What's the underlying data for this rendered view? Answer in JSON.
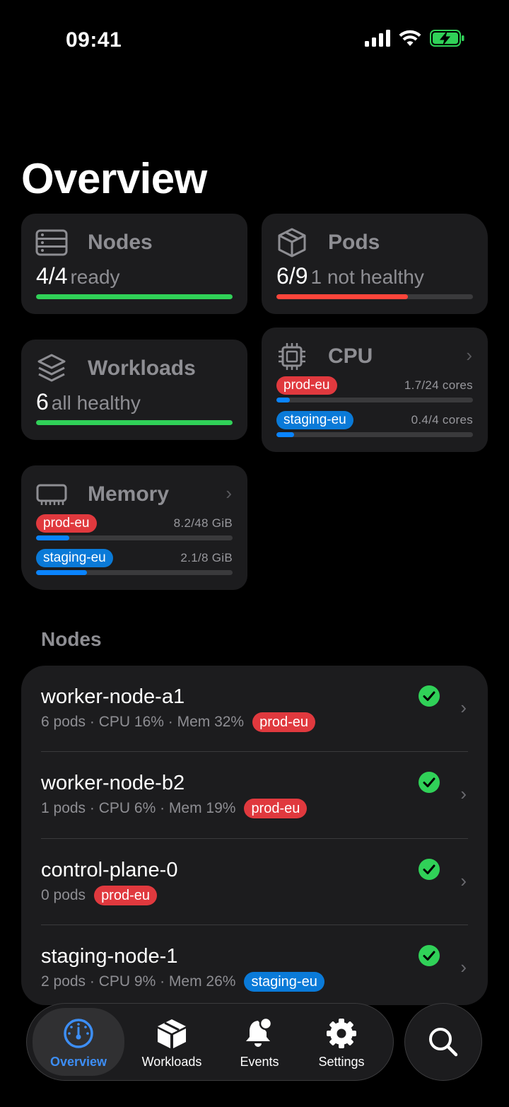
{
  "status": {
    "time": "09:41"
  },
  "page_title": "Overview",
  "cards": {
    "nodes": {
      "label": "Nodes",
      "value": "4/4",
      "sub": "ready",
      "progress": 1.0,
      "color": "#30d158",
      "icon": "server-rack-icon"
    },
    "pods": {
      "label": "Pods",
      "value": "6/9",
      "sub": "1 not healthy",
      "progress": 0.67,
      "color": "#ff453a",
      "icon": "cube-icon"
    },
    "workloads": {
      "label": "Workloads",
      "value": "6",
      "sub": "all healthy",
      "progress": 1.0,
      "color": "#30d158",
      "icon": "stack-layers-icon"
    },
    "cpu": {
      "label": "CPU",
      "icon": "cpu-chip-icon",
      "rows": [
        {
          "cluster": "prod-eu",
          "amount": "1.7/24 cores",
          "progress": 0.07,
          "color": "red"
        },
        {
          "cluster": "staging-eu",
          "amount": "0.4/4 cores",
          "progress": 0.09,
          "color": "blue"
        }
      ]
    },
    "memory": {
      "label": "Memory",
      "icon": "memory-module-icon",
      "rows": [
        {
          "cluster": "prod-eu",
          "amount": "8.2/48 GiB",
          "progress": 0.17,
          "color": "red"
        },
        {
          "cluster": "staging-eu",
          "amount": "2.1/8 GiB",
          "progress": 0.26,
          "color": "blue"
        }
      ]
    }
  },
  "nodes_section": {
    "title": "Nodes",
    "items": [
      {
        "name": "worker-node-a1",
        "meta": "6 pods · CPU 16% · Mem 32%",
        "cluster": "prod-eu",
        "cluster_color": "red"
      },
      {
        "name": "worker-node-b2",
        "meta": "1 pods · CPU 6% · Mem 19%",
        "cluster": "prod-eu",
        "cluster_color": "red"
      },
      {
        "name": "control-plane-0",
        "meta": "0 pods",
        "cluster": "prod-eu",
        "cluster_color": "red"
      },
      {
        "name": "staging-node-1",
        "meta": "2 pods · CPU 9% · Mem 26%",
        "cluster": "staging-eu",
        "cluster_color": "blue"
      }
    ]
  },
  "tabs": [
    {
      "label": "Overview",
      "icon": "gauge-icon",
      "active": true
    },
    {
      "label": "Workloads",
      "icon": "box-icon",
      "active": false
    },
    {
      "label": "Events",
      "icon": "bell-badge-icon",
      "active": false
    },
    {
      "label": "Settings",
      "icon": "gear-icon",
      "active": false
    }
  ],
  "colors": {
    "accent": "#3d8ef5",
    "healthy": "#30d158",
    "unhealthy": "#ff453a",
    "prod_pill": "#e0393e",
    "staging_pill": "#0a7ad8"
  }
}
